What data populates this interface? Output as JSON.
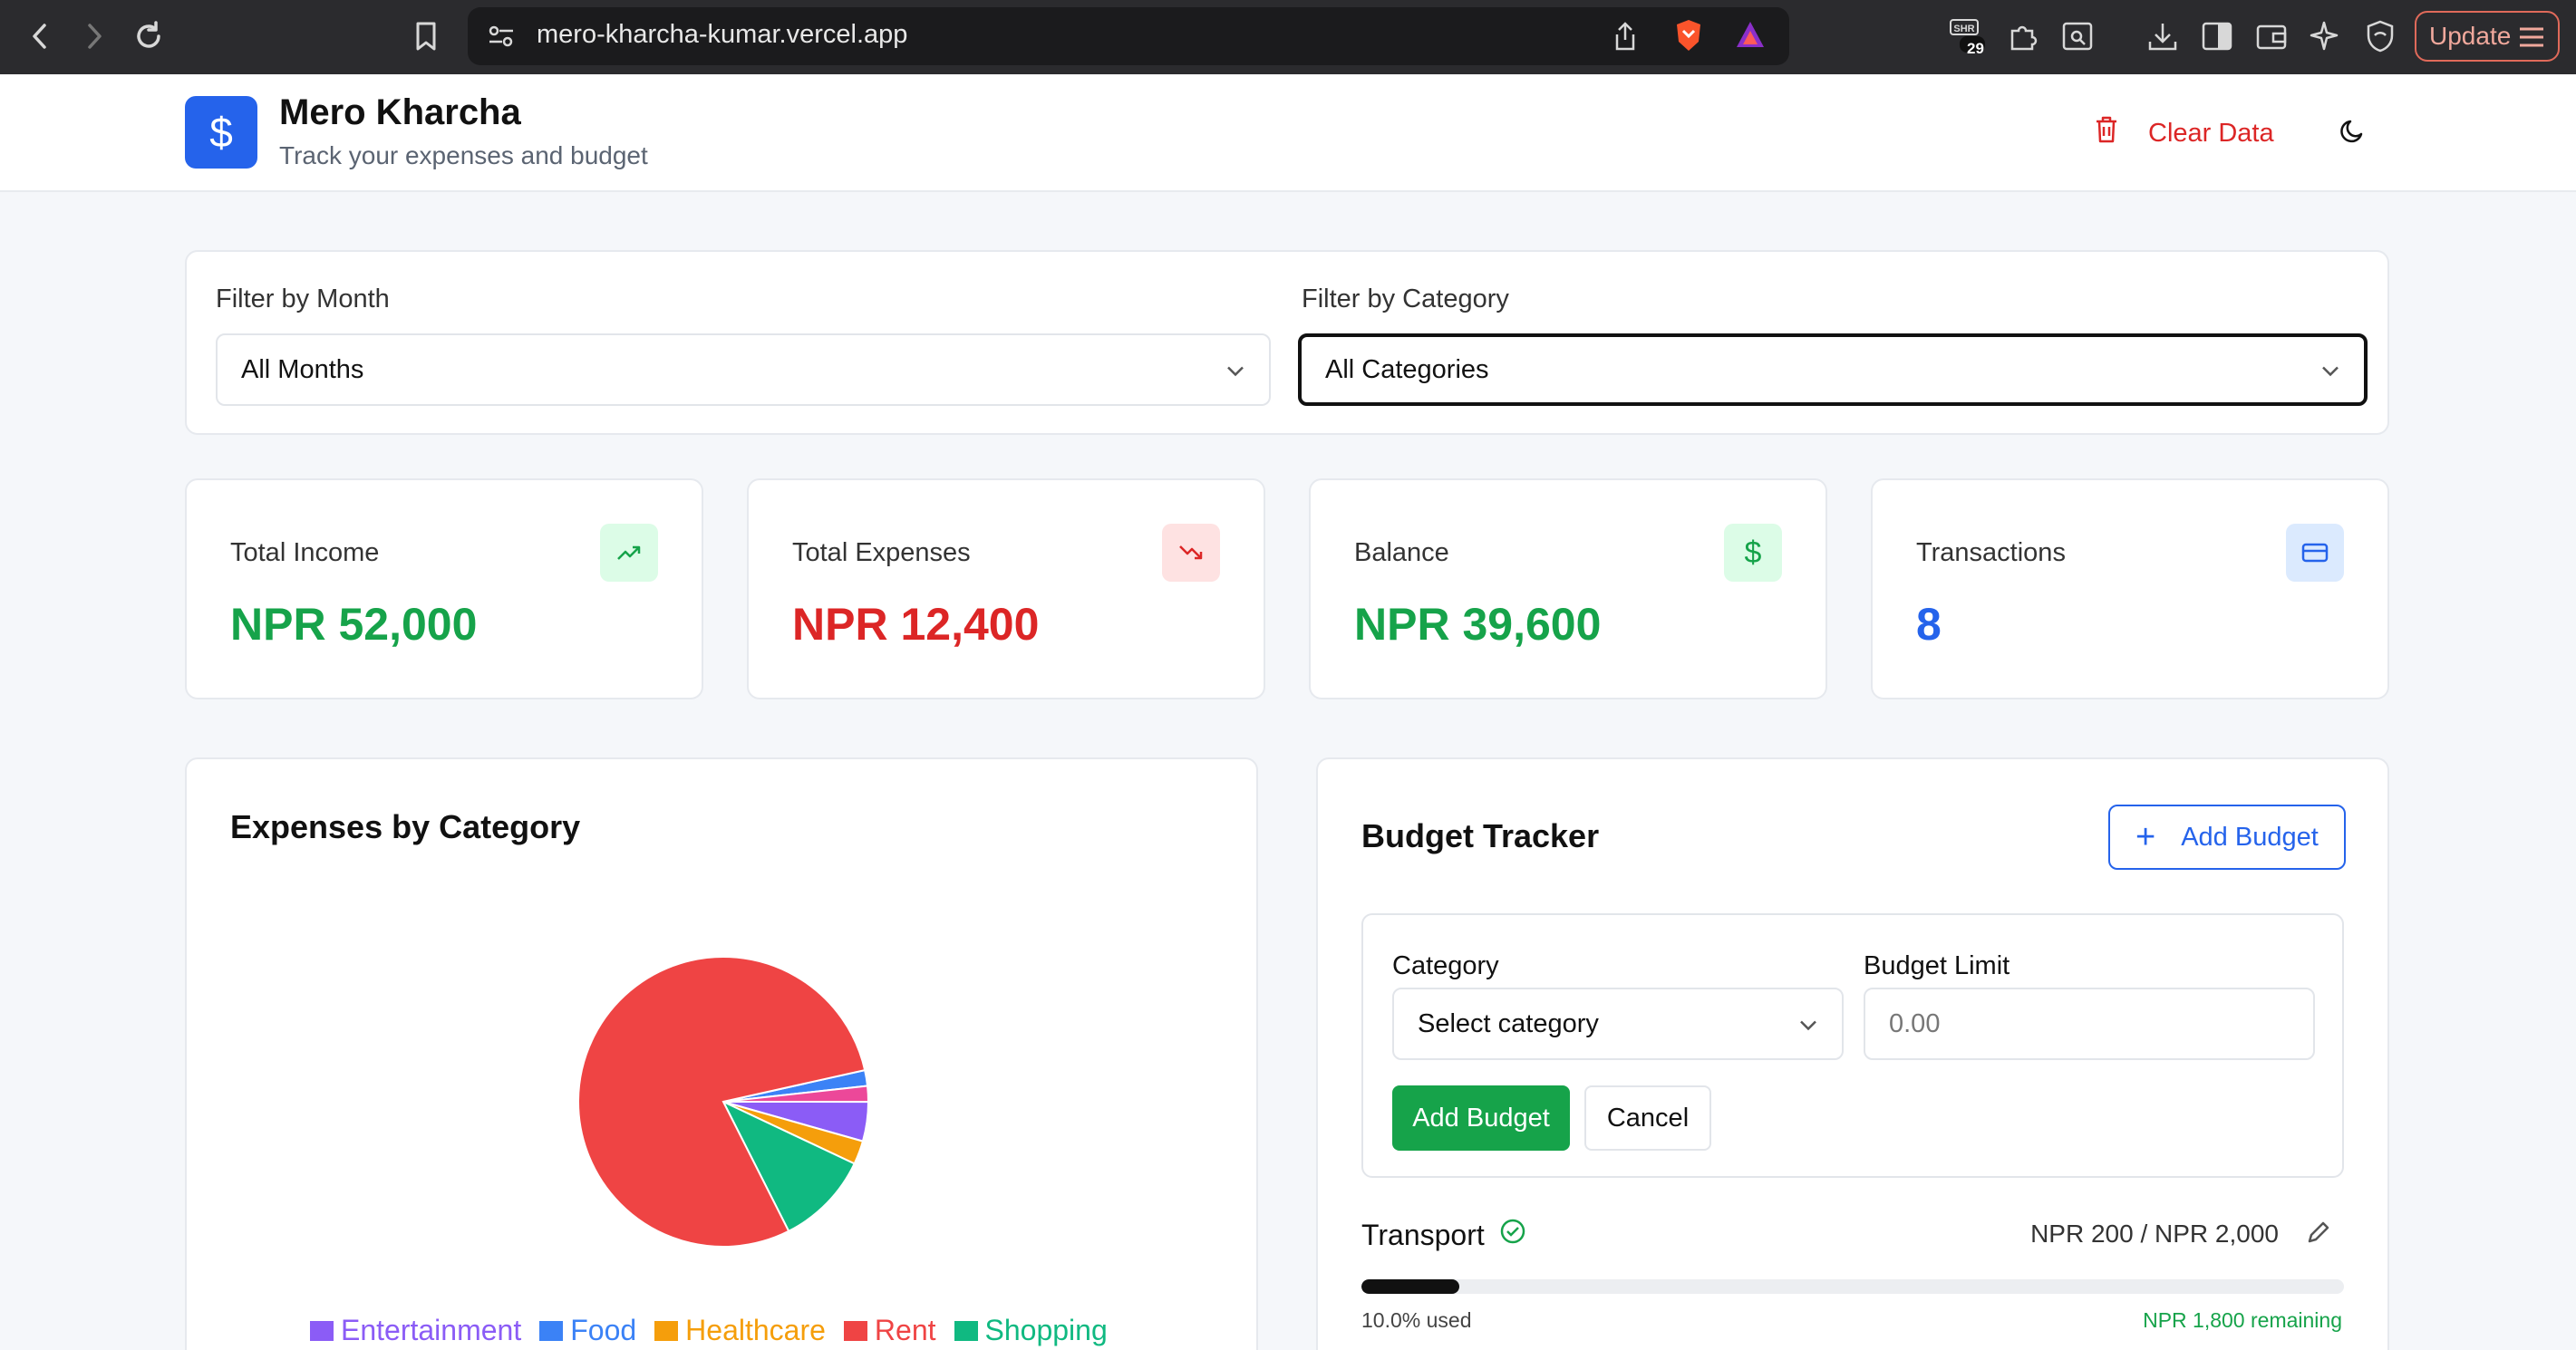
{
  "browser": {
    "url": "mero-kharcha-kumar.vercel.app",
    "update_label": "Update",
    "extension_badge": "29"
  },
  "app": {
    "title": "Mero Kharcha",
    "subtitle": "Track your expenses and budget",
    "clear_label": "Clear Data",
    "logo_symbol": "$"
  },
  "filters": {
    "month_label": "Filter by Month",
    "month_value": "All Months",
    "category_label": "Filter by Category",
    "category_value": "All Categories"
  },
  "stats": [
    {
      "label": "Total Income",
      "value": "NPR 52,000",
      "color": "#16a34a",
      "icon": "trending-up-icon"
    },
    {
      "label": "Total Expenses",
      "value": "NPR 12,400",
      "color": "#dc2626",
      "icon": "trending-down-icon"
    },
    {
      "label": "Balance",
      "value": "NPR 39,600",
      "color": "#16a34a",
      "icon": "dollar-icon"
    },
    {
      "label": "Transactions",
      "value": "8",
      "color": "#2563eb",
      "icon": "credit-card-icon"
    }
  ],
  "expenses_chart": {
    "title": "Expenses by Category"
  },
  "chart_data": {
    "type": "pie",
    "title": "Expenses by Category",
    "categories": [
      "Rent",
      "Shopping",
      "Healthcare",
      "Entertainment",
      "Healthcare",
      "Food"
    ],
    "slices": [
      {
        "name": "Rent",
        "value": 9000,
        "color": "#ef4444"
      },
      {
        "name": "Shopping",
        "value": 1200,
        "color": "#10b981"
      },
      {
        "name": "Healthcare",
        "value": 300,
        "color": "#f59e0b"
      },
      {
        "name": "Entertainment",
        "value": 500,
        "color": "#8b5cf6"
      },
      {
        "name": "Healthcare",
        "value": 200,
        "color": "#ec4899"
      },
      {
        "name": "Food",
        "value": 200,
        "color": "#3b82f6"
      }
    ],
    "legend": [
      {
        "name": "Entertainment",
        "color": "#8b5cf6"
      },
      {
        "name": "Food",
        "color": "#3b82f6"
      },
      {
        "name": "Healthcare",
        "color": "#f59e0b"
      },
      {
        "name": "Rent",
        "color": "#ef4444"
      },
      {
        "name": "Shopping",
        "color": "#10b981"
      }
    ],
    "legend_position": "bottom"
  },
  "budget": {
    "title": "Budget Tracker",
    "add_label": "Add Budget",
    "form": {
      "category_label": "Category",
      "category_placeholder": "Select category",
      "limit_label": "Budget Limit",
      "limit_placeholder": "0.00",
      "submit_label": "Add Budget",
      "cancel_label": "Cancel"
    },
    "items": [
      {
        "name": "Transport",
        "amount": "NPR 200 / NPR 2,000",
        "used_fraction": 0.1,
        "used_text": "10.0% used",
        "remaining_text": "NPR 1,800 remaining"
      }
    ]
  }
}
